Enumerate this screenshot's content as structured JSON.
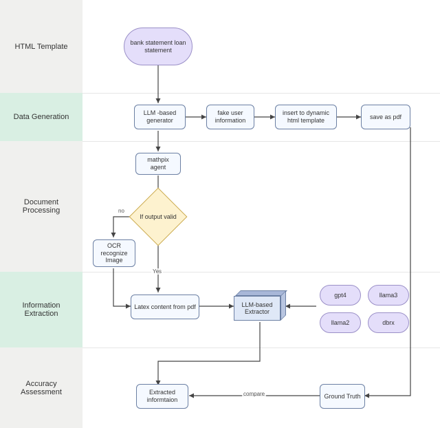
{
  "lanes": {
    "l0": "HTML Template",
    "l1": "Data Generation",
    "l2": "Document Processing",
    "l3": "Information Extraction",
    "l4": "Accuracy Assessment"
  },
  "nodes": {
    "start": "bank statement\nloan statement",
    "gen": "LLM -based generator",
    "fake": "fake user information",
    "insert": "insert to dynamic html template",
    "savepdf": "save as pdf",
    "mathpix": "mathpix agent",
    "ifvalid": "If output valid",
    "ocr": "OCR recognize Image",
    "latex": "Latex content from pdf",
    "extractor": "LLM-based Extractor",
    "gpt4": "gpt4",
    "llama3": "llama3",
    "llama2": "llama2",
    "dbrx": "dbrx",
    "extracted": "Extracted informtaion",
    "gt": "Ground Truth"
  },
  "edges": {
    "no": "no",
    "yes": "Yes",
    "compare": "compare"
  }
}
